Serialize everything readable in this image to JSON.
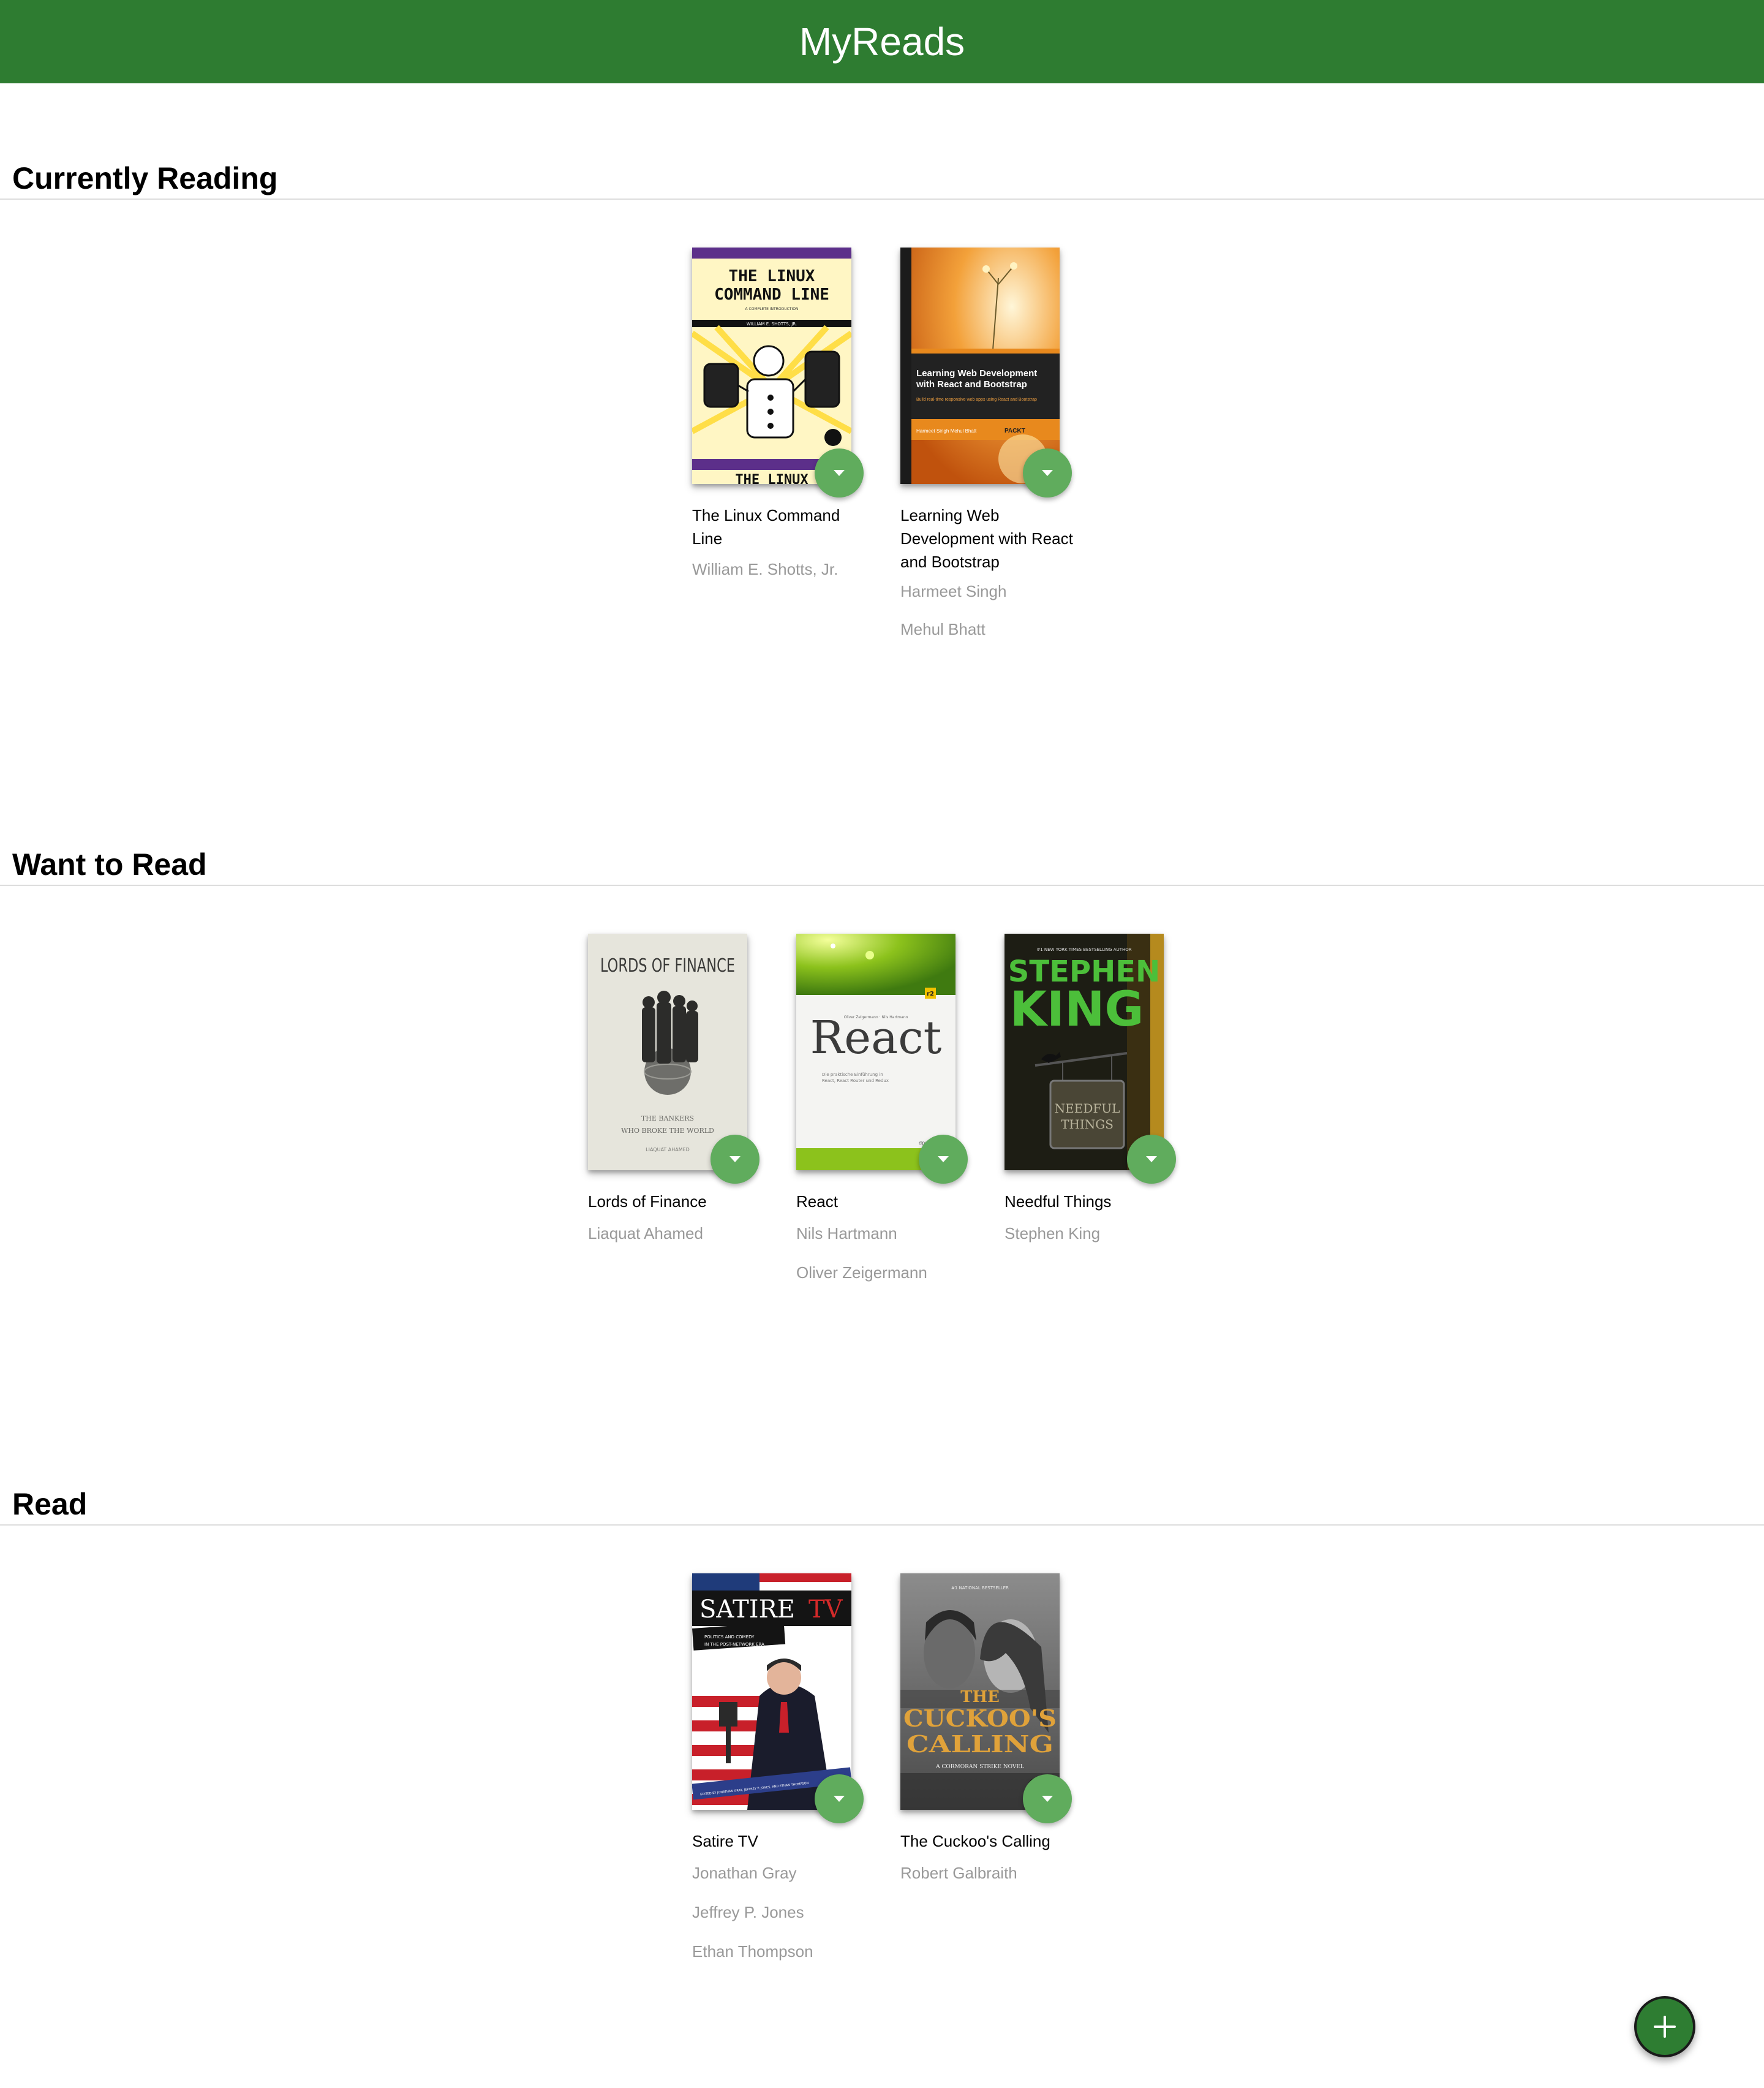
{
  "app": {
    "title": "MyReads"
  },
  "colors": {
    "header": "#2e7c31",
    "changer": "#60ac5d",
    "add_button": "#2e7d32",
    "author_text": "#999999"
  },
  "shelves": [
    {
      "title": "Currently Reading",
      "books": [
        {
          "title": "The Linux Command Line",
          "authors": [
            "William E. Shotts, Jr."
          ],
          "cover": {
            "title_lines": [
              "THE LINUX",
              "COMMAND LINE"
            ],
            "subtitle": "A COMPLETE INTRODUCTION",
            "byline": "WILLIAM E. SHOTTS, JR.",
            "footer": "THE LINUX"
          }
        },
        {
          "title": "Learning Web Development with React and Bootstrap",
          "authors": [
            "Harmeet Singh",
            "Mehul Bhatt"
          ],
          "cover": {
            "title_lines": [
              "Learning Web Development",
              "with React and Bootstrap"
            ],
            "subtitle": "Build real-time responsive web apps using React and Bootstrap",
            "byline": "Harmeet Singh  Mehul Bhatt",
            "publisher": "PACKT"
          }
        }
      ]
    },
    {
      "title": "Want to Read",
      "books": [
        {
          "title": "Lords of Finance",
          "authors": [
            "Liaquat Ahamed"
          ],
          "cover": {
            "title_lines": [
              "LORDS OF FINANCE"
            ],
            "subtitle_lines": [
              "THE BANKERS",
              "WHO BROKE THE WORLD"
            ],
            "byline": "LIAQUAT AHAMED"
          }
        },
        {
          "title": "React",
          "authors": [
            "Nils Hartmann",
            "Oliver Zeigermann"
          ],
          "cover": {
            "title_lines": [
              "React"
            ],
            "byline": "Oliver Zeigermann · Nils Hartmann",
            "subtitle_lines": [
              "Die praktische Einführung in",
              "React, React Router und Redux"
            ],
            "badge": "r2",
            "publisher": "dpunkt"
          }
        },
        {
          "title": "Needful Things",
          "authors": [
            "Stephen King"
          ],
          "cover": {
            "kicker": "#1 NEW YORK TIMES BESTSELLING AUTHOR",
            "title_lines": [
              "STEPHEN",
              "KING"
            ],
            "sign_lines": [
              "NEEDFUL",
              "THINGS"
            ]
          }
        }
      ]
    },
    {
      "title": "Read",
      "books": [
        {
          "title": "Satire TV",
          "authors": [
            "Jonathan Gray",
            "Jeffrey P. Jones",
            "Ethan Thompson"
          ],
          "cover": {
            "title_lines": [
              "SATIRE",
              "TV"
            ],
            "subtitle_lines": [
              "POLITICS AND COMEDY",
              "IN THE POST-NETWORK ERA"
            ],
            "byline": "EDITED BY JONATHAN GRAY, JEFFREY P. JONES, AND ETHAN THOMPSON"
          }
        },
        {
          "title": "The Cuckoo's Calling",
          "authors": [
            "Robert Galbraith"
          ],
          "cover": {
            "kicker": "#1 NATIONAL BESTSELLER",
            "title_lines": [
              "THE",
              "CUCKOO'S",
              "CALLING"
            ],
            "subtitle": "A CORMORAN STRIKE NOVEL"
          }
        }
      ]
    }
  ],
  "add_book_button": {
    "icon": "plus-icon"
  }
}
